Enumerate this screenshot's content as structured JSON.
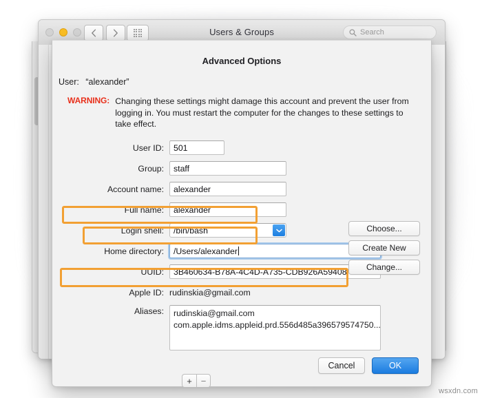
{
  "window": {
    "title": "Users & Groups",
    "traffic_lights": [
      {
        "name": "close-button",
        "color": "#d4d4d4",
        "state": "inactive"
      },
      {
        "name": "minimize-button",
        "color": "#fbbf24",
        "state": "active"
      },
      {
        "name": "zoom-button",
        "color": "#d4d4d4",
        "state": "inactive"
      }
    ],
    "nav": {
      "back_icon": "chevron-left-icon",
      "forward_icon": "chevron-right-icon",
      "grid_icon": "show-all-grid-icon"
    },
    "search": {
      "placeholder": "Search",
      "value": "",
      "icon": "search-icon"
    }
  },
  "sheet": {
    "title": "Advanced Options",
    "user_label": "User:",
    "user_value": "“alexander”",
    "warning_tag": "WARNING:",
    "warning_text": "Changing these settings might damage this account and prevent the user from logging in. You must restart the computer for the changes to these settings to take effect.",
    "fields": {
      "user_id": {
        "label": "User ID:",
        "value": "501"
      },
      "group": {
        "label": "Group:",
        "value": "staff"
      },
      "account_name": {
        "label": "Account name:",
        "value": "alexander",
        "highlighted": true
      },
      "full_name": {
        "label": "Full name:",
        "value": "alexander",
        "highlighted": true
      },
      "login_shell": {
        "label": "Login shell:",
        "value": "/bin/bash",
        "chevron_icon": "chevron-down-icon"
      },
      "home_directory": {
        "label": "Home directory:",
        "value": "/Users/alexander",
        "focused": true,
        "highlighted": true
      },
      "uuid": {
        "label": "UUID:",
        "value": "3B460634-B78A-4C4D-A735-CDB926A59408"
      },
      "apple_id": {
        "label": "Apple ID:",
        "value": "rudinskia@gmail.com"
      },
      "aliases": {
        "label": "Aliases:",
        "values": [
          "rudinskia@gmail.com",
          "com.apple.idms.appleid.prd.556d485a396579574750..."
        ]
      }
    },
    "side_buttons": {
      "choose": "Choose...",
      "create_new": "Create New",
      "change": "Change..."
    },
    "alias_controls": {
      "add": "+",
      "remove": "−"
    },
    "footer": {
      "cancel": "Cancel",
      "ok": "OK",
      "ok_accent": "#1b7ce0"
    }
  },
  "annotation": {
    "color": "#f2a033",
    "count": 3
  },
  "watermark": "wsxdn.com"
}
